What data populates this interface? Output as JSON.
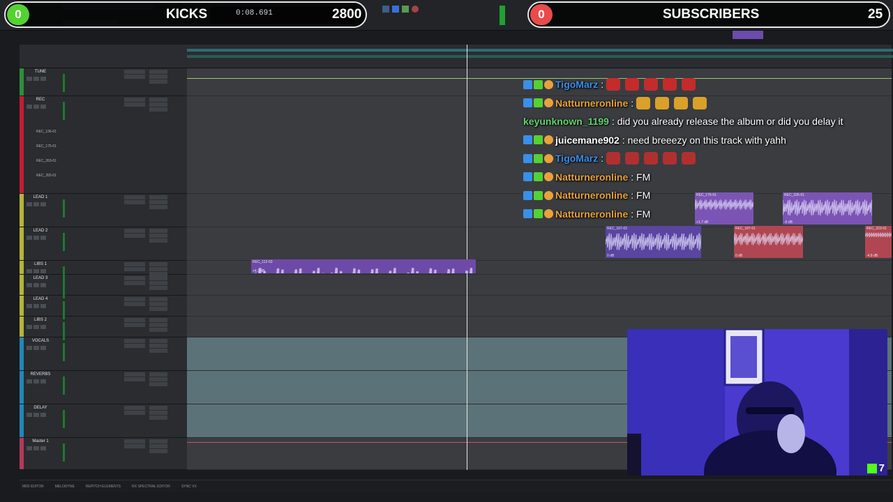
{
  "overlay": {
    "kicks": {
      "count": "0",
      "label": "KICKS",
      "time": "0:08.691",
      "total": "2800"
    },
    "subs": {
      "count": "0",
      "label": "SUBSCRIBERS",
      "total": "25"
    },
    "colors": {
      "kicks_circle": "#53d232",
      "subs_circle": "#e94b4b",
      "accent": "#53fc18"
    }
  },
  "tracks": [
    {
      "name": "TUNE",
      "color": "#2e8f3c"
    },
    {
      "name": "REC",
      "color": "#c21d34",
      "sub": [
        "REC_136-01",
        "REC_175-01",
        "REC_263-01",
        "REC_265-01"
      ]
    },
    {
      "name": "LEAD 1",
      "color": "#b6b43a"
    },
    {
      "name": "LEAD 2",
      "color": "#b6b43a"
    },
    {
      "name": "LIBS 1",
      "color": "#b6b43a"
    },
    {
      "name": "LEAD 3",
      "color": "#b6b43a"
    },
    {
      "name": "LEAD 4",
      "color": "#b6b43a"
    },
    {
      "name": "LIBS 2",
      "color": "#b6b43a"
    },
    {
      "name": "VOCALS",
      "color": "#2486b8"
    },
    {
      "name": "REVERBS",
      "color": "#2486b8"
    },
    {
      "name": "DELAY",
      "color": "#2486b8"
    },
    {
      "name": "Master 1",
      "color": "#b03a5a"
    }
  ],
  "clips": [
    {
      "name": "REC_112-03",
      "label": "+4.3 dB",
      "color": "#6e4aa8"
    },
    {
      "name": "REC_176-01",
      "label": "+1.7 dB",
      "color": "#7b54b5"
    },
    {
      "name": "REC_226-01",
      "label": "-0 dB",
      "color": "#7b54b5"
    },
    {
      "name": "REC_167-03",
      "label": "0 dB",
      "color": "#5a45a0"
    },
    {
      "name": "REC_187-01",
      "label": "0 dB",
      "color": "#b04651"
    },
    {
      "name": "REC_223-01",
      "label": "-4.8 dB",
      "color": "#b04651"
    }
  ],
  "chat": [
    {
      "user": "TigoMarz",
      "user_color": "#3a8fe8",
      "sep": ":",
      "text": "",
      "emotes": 5,
      "emote_color": "#c42b2b"
    },
    {
      "user": "Natturneronline",
      "user_color": "#e9a23b",
      "sep": ":",
      "text": "",
      "emotes": 4,
      "emote_color": "#d9a02a"
    },
    {
      "user": "keyunknown_1199",
      "user_color": "#5fd36a",
      "sep": ":",
      "text": "did you already release the album or did you delay it",
      "emotes": 0,
      "no_badges": true
    },
    {
      "user": "juicemane902",
      "user_color": "#ffffff",
      "sep": ":",
      "text": "need breeezy on this track with yahh",
      "emotes": 0
    },
    {
      "user": "TigoMarz",
      "user_color": "#3a8fe8",
      "sep": ":",
      "text": "",
      "emotes": 5,
      "emote_color": "#b03030"
    },
    {
      "user": "Natturneronline",
      "user_color": "#e9a23b",
      "sep": ":",
      "text": "FM",
      "emotes": 0
    },
    {
      "user": "Natturneronline",
      "user_color": "#e9a23b",
      "sep": ":",
      "text": "FM",
      "emotes": 0
    },
    {
      "user": "Natturneronline",
      "user_color": "#e9a23b",
      "sep": ":",
      "text": "FM",
      "emotes": 0
    }
  ],
  "webcam": {
    "viewers": "7"
  },
  "bottom": [
    "MIDI EDITOR",
    "MELODYNE",
    "REPITCH ELEMENTS",
    "RX SPECTRAL EDITOR",
    "SYNC VX"
  ]
}
